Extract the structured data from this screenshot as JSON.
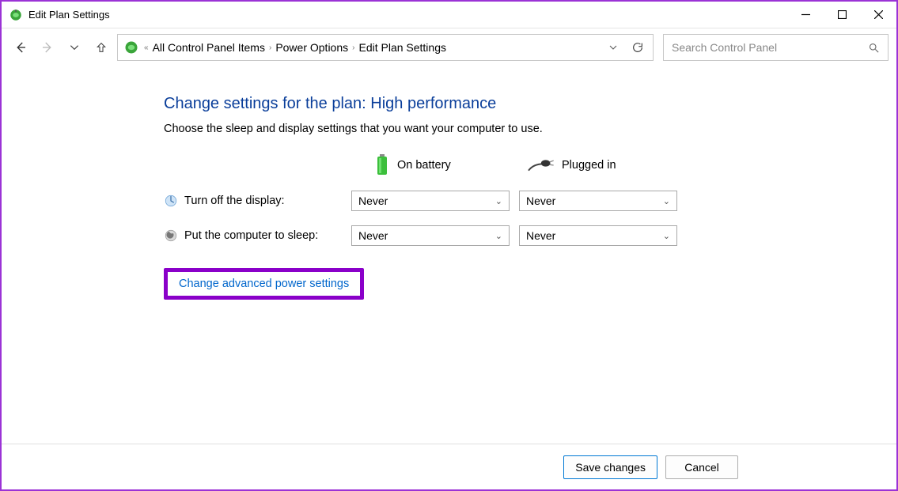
{
  "window": {
    "title": "Edit Plan Settings"
  },
  "breadcrumb": {
    "items": [
      "All Control Panel Items",
      "Power Options",
      "Edit Plan Settings"
    ]
  },
  "search": {
    "placeholder": "Search Control Panel"
  },
  "page": {
    "heading": "Change settings for the plan: High performance",
    "description": "Choose the sleep and display settings that you want your computer to use.",
    "columns": {
      "battery": "On battery",
      "plugged": "Plugged in"
    },
    "rows": {
      "display_off": {
        "label": "Turn off the display:",
        "battery_value": "Never",
        "plugged_value": "Never"
      },
      "sleep": {
        "label": "Put the computer to sleep:",
        "battery_value": "Never",
        "plugged_value": "Never"
      }
    },
    "advanced_link": "Change advanced power settings"
  },
  "footer": {
    "save": "Save changes",
    "cancel": "Cancel"
  }
}
